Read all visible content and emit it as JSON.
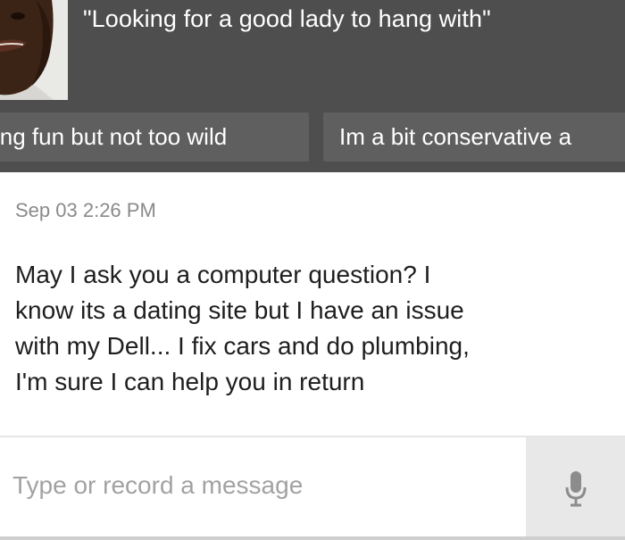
{
  "profile": {
    "tagline": "\"Looking for a good lady to hang with\"",
    "tags": [
      "ing fun but not too wild",
      "Im a bit conservative a"
    ],
    "header_color": "#4e4e4e",
    "tag_color": "#5f5f5f"
  },
  "message": {
    "timestamp": "Sep 03 2:26 PM",
    "body": "May I ask you a computer question?  I\nknow its a dating site but I have an issue\nwith my Dell... I fix cars and do plumbing,\nI'm sure I can help you in return"
  },
  "composer": {
    "placeholder": "Type or record a message",
    "value": "",
    "mic_icon": "microphone-icon"
  }
}
